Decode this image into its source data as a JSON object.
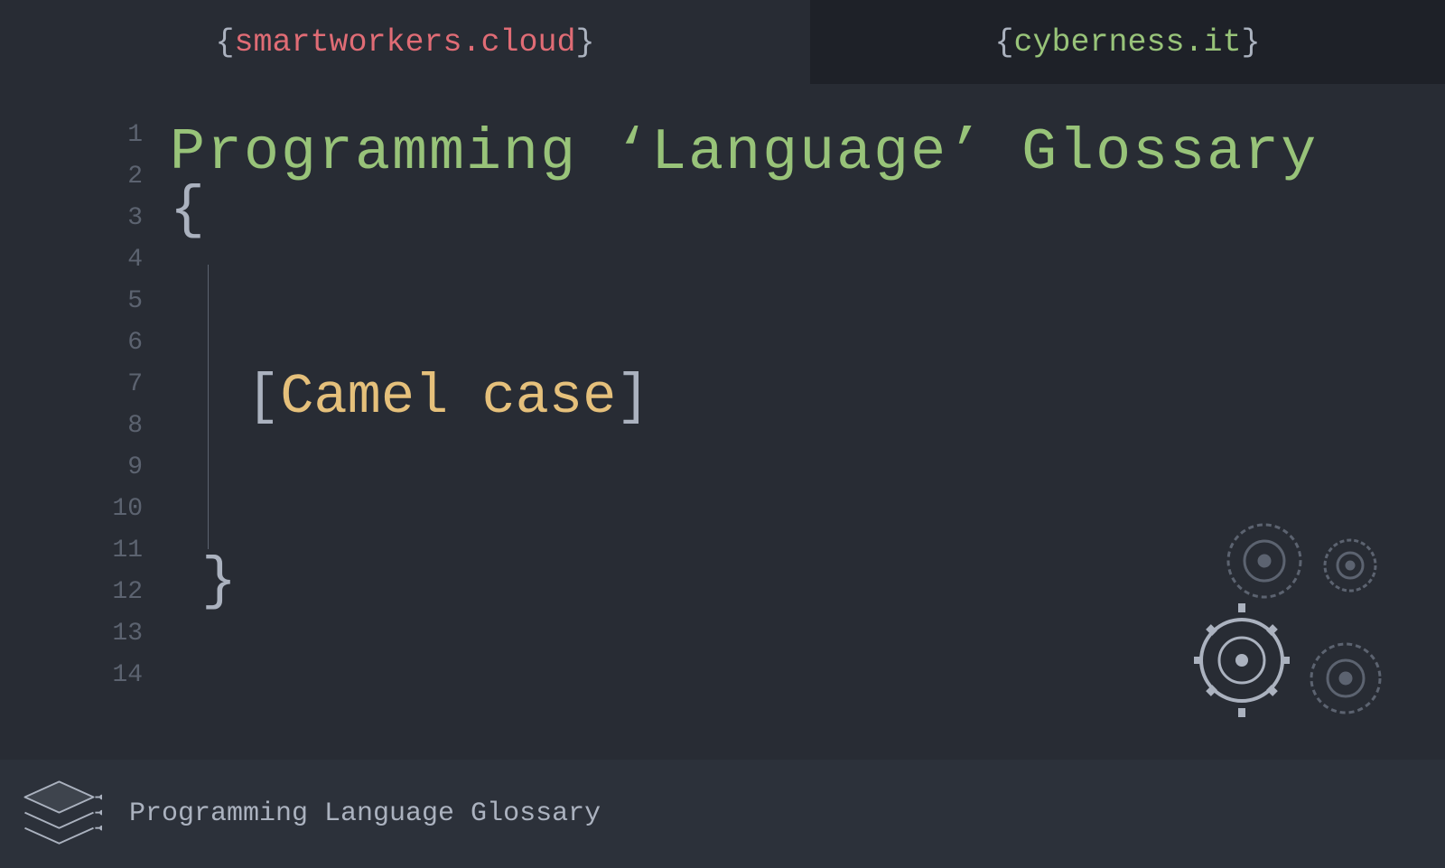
{
  "tabs": {
    "left": "smartworkers.cloud",
    "right": "cyberness.it"
  },
  "line_numbers": [
    "1",
    "2",
    "3",
    "4",
    "5",
    "6",
    "7",
    "8",
    "9",
    "10",
    "11",
    "12",
    "13",
    "14"
  ],
  "title": "Programming ‘Language’ Glossary",
  "open_brace": "{",
  "close_brace": "}",
  "term": "Camel case",
  "bracket_open": "[",
  "bracket_close": "]",
  "footer": {
    "text": "Programming Language Glossary"
  }
}
